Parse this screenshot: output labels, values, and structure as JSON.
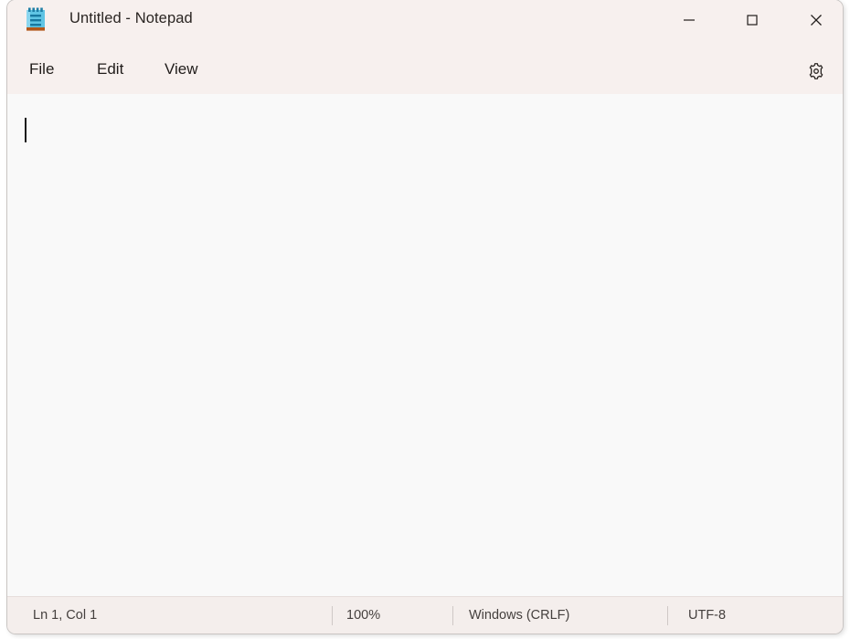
{
  "window": {
    "title": "Untitled - Notepad",
    "app_icon": "notepad-icon",
    "colors": {
      "title_bar_bg": "#f7f0ee",
      "menu_bar_bg": "#f7f0ee",
      "editor_bg": "#f9f9f9",
      "status_bar_bg": "#f4eeec",
      "text": "#201c1a",
      "icon_blue": "#36a8d6",
      "icon_blue_dark": "#1a7fa8",
      "icon_orange": "#b35a16"
    },
    "controls": {
      "minimize": "—",
      "maximize": "□",
      "close": "✕",
      "minimize_name": "minimize-button",
      "maximize_name": "maximize-button",
      "close_name": "close-button"
    }
  },
  "menu": {
    "items": [
      {
        "label": "File"
      },
      {
        "label": "Edit"
      },
      {
        "label": "View"
      }
    ],
    "settings_icon": "gear-icon"
  },
  "editor": {
    "content": "",
    "caret_visible": true
  },
  "status_bar": {
    "position": "Ln 1, Col 1",
    "zoom": "100%",
    "line_ending": "Windows (CRLF)",
    "encoding": "UTF-8"
  }
}
